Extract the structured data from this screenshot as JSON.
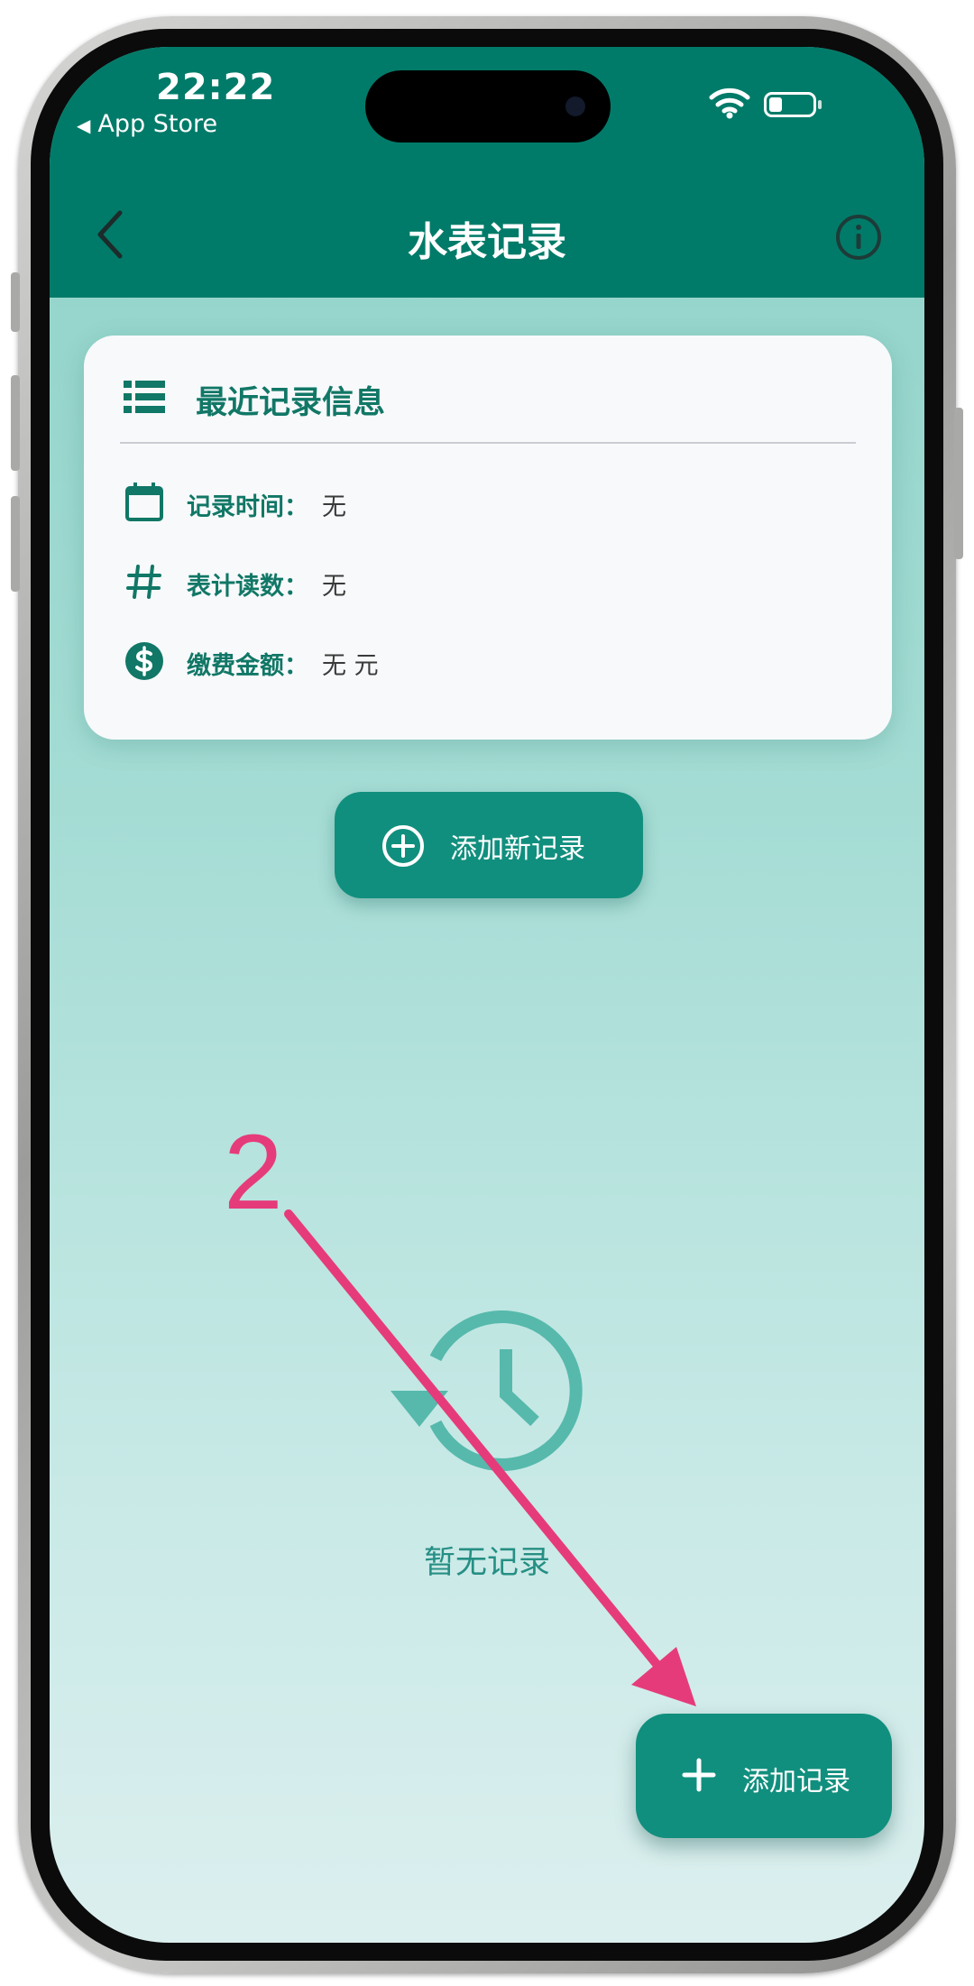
{
  "status_bar": {
    "time": "22:22",
    "back_app": "App Store",
    "icons": [
      "wifi-icon",
      "battery-icon"
    ]
  },
  "nav": {
    "title": "水表记录",
    "back_icon": "chevron-left-icon",
    "info_icon": "info-icon"
  },
  "card": {
    "title": "最近记录信息",
    "title_icon": "list-icon",
    "rows": [
      {
        "icon": "calendar-icon",
        "label": "记录时间：",
        "value": "无"
      },
      {
        "icon": "hash-icon",
        "label": "表计读数：",
        "value": "无"
      },
      {
        "icon": "dollar-icon",
        "label": "缴费金额：",
        "value": "无 元"
      }
    ]
  },
  "add_new_button": {
    "label": "添加新记录",
    "icon": "add-circle-icon"
  },
  "empty_state": {
    "icon": "history-icon",
    "text": "暂无记录"
  },
  "fab": {
    "label": "添加记录",
    "icon": "plus-icon"
  },
  "annotation": {
    "number": "2"
  },
  "colors": {
    "header": "#017b69",
    "accent": "#118f7e",
    "primary_text": "#117766",
    "annotation": "#e63b7a"
  }
}
